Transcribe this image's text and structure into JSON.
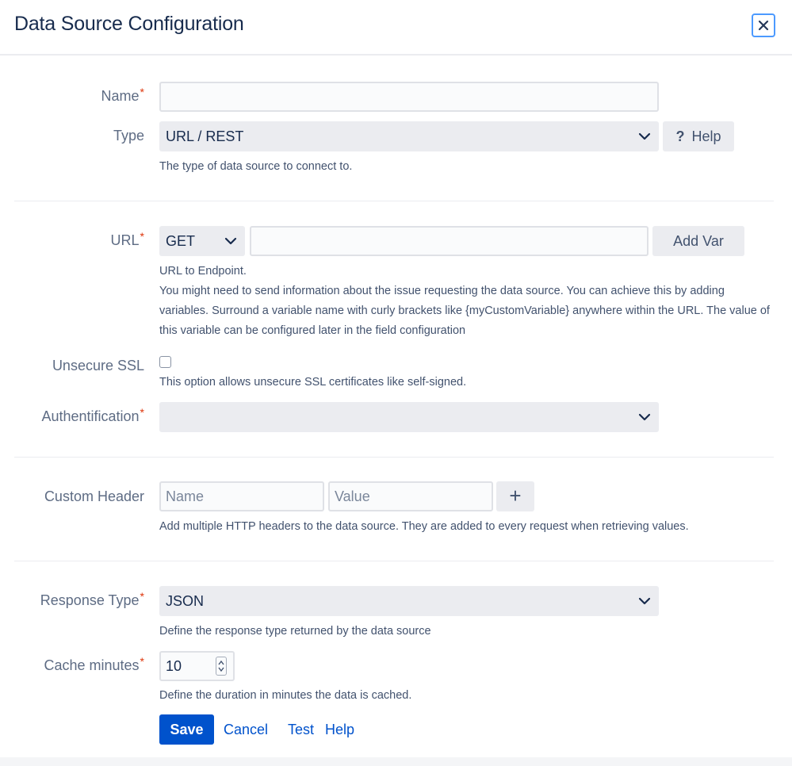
{
  "dialog": {
    "title": "Data Source Configuration",
    "close_icon": "close-icon"
  },
  "fields": {
    "name": {
      "label": "Name",
      "required_mark": "*",
      "value": ""
    },
    "type": {
      "label": "Type",
      "selected": "URL / REST",
      "help": "The type of data source to connect to.",
      "help_button": "Help",
      "help_icon": "?"
    },
    "url": {
      "label": "URL",
      "required_mark": "*",
      "method": "GET",
      "value": "",
      "add_var_button": "Add Var",
      "help_line1": "URL to Endpoint.",
      "help_line2": "You might need to send information about the issue requesting the data source. You can achieve this by adding variables. Surround a variable name with curly brackets like {myCustomVariable} anywhere within the URL. The value of this variable can be configured later in the field configuration"
    },
    "unsecure_ssl": {
      "label": "Unsecure SSL",
      "checked": false,
      "help": "This option allows unsecure SSL certificates like self-signed."
    },
    "authentification": {
      "label": "Authentification",
      "required_mark": "*",
      "selected": ""
    },
    "custom_header": {
      "label": "Custom Header",
      "name_placeholder": "Name",
      "value_placeholder": "Value",
      "add_button": "+",
      "help": "Add multiple HTTP headers to the data source. They are added to every request when retrieving values."
    },
    "response_type": {
      "label": "Response Type",
      "required_mark": "*",
      "selected": "JSON",
      "help": "Define the response type returned by the data source"
    },
    "cache_minutes": {
      "label": "Cache minutes",
      "required_mark": "*",
      "value": "10",
      "help": "Define the duration in minutes the data is cached."
    }
  },
  "actions": {
    "save": "Save",
    "cancel": "Cancel",
    "test": "Test",
    "help": "Help"
  },
  "colors": {
    "primary": "#0052cc",
    "required": "#de350b",
    "focus": "#4c9aff"
  }
}
